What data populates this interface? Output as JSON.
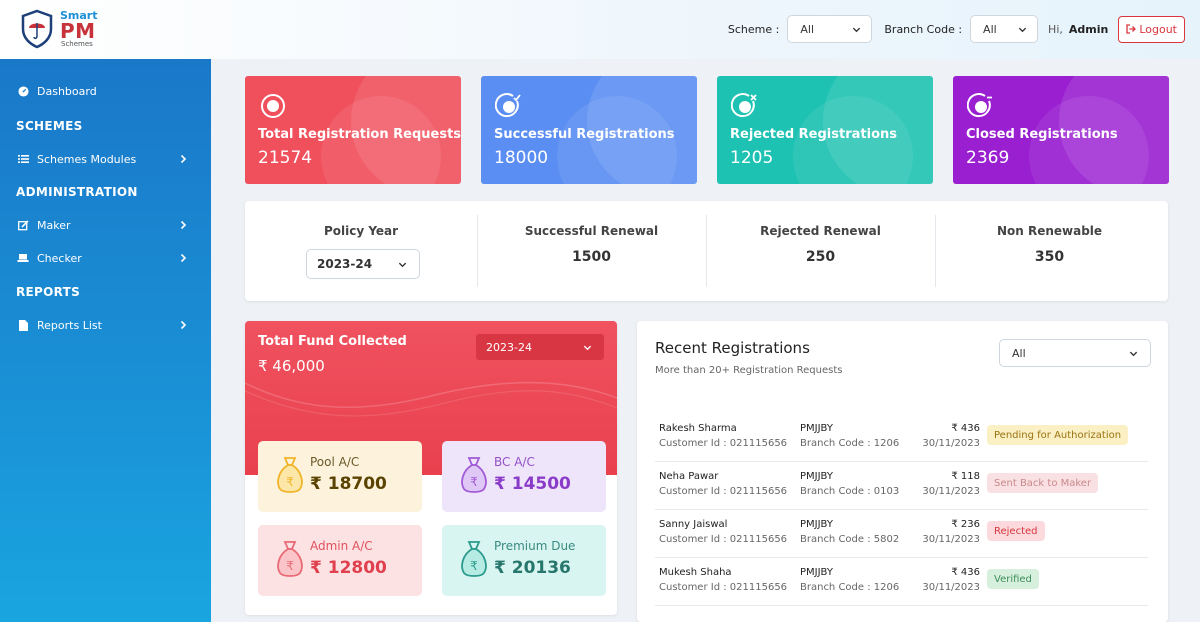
{
  "brand": {
    "smart": "Smart",
    "pm": "PM",
    "schemes": "Schemes"
  },
  "header": {
    "scheme_label": "Scheme :",
    "scheme_value": "All",
    "branch_label": "Branch Code :",
    "branch_value": "All",
    "greeting": "Hi,",
    "user": "Admin",
    "logout": "Logout"
  },
  "sidebar": {
    "dashboard": "Dashboard",
    "schemes_head": "SCHEMES",
    "schemes_modules": "Schemes Modules",
    "admin_head": "ADMINISTRATION",
    "maker": "Maker",
    "checker": "Checker",
    "reports_head": "REPORTS",
    "reports_list": "Reports List"
  },
  "stats": [
    {
      "label": "Total Registration Requests",
      "value": "21574",
      "color": "#f0505c"
    },
    {
      "label": "Successful Registrations",
      "value": "18000",
      "color": "#5b8ef2"
    },
    {
      "label": "Rejected Registrations",
      "value": "1205",
      "color": "#1ec2b2"
    },
    {
      "label": "Closed Registrations",
      "value": "2369",
      "color": "#9a1fd1"
    }
  ],
  "renewal": {
    "policy_year_label": "Policy Year",
    "policy_year_value": "2023-24",
    "successful_label": "Successful Renewal",
    "successful_value": "1500",
    "rejected_label": "Rejected Renewal",
    "rejected_value": "250",
    "non_label": "Non Renewable",
    "non_value": "350"
  },
  "fund": {
    "title": "Total Fund Collected",
    "amount": "₹ 46,000",
    "year": "2023-24",
    "accounts": [
      {
        "label": "Pool A/C",
        "value": "₹ 18700"
      },
      {
        "label": "BC A/C",
        "value": "₹ 14500"
      },
      {
        "label": "Admin A/C",
        "value": "₹ 12800"
      },
      {
        "label": "Premium Due",
        "value": "₹ 20136"
      }
    ]
  },
  "recent": {
    "title": "Recent Registrations",
    "subtitle": "More than 20+ Registration Requests",
    "filter": "All",
    "rows": [
      {
        "name": "Rakesh Sharma",
        "cust": "Customer Id : 021115656",
        "scheme": "PMJJBY",
        "branch": "Branch Code : 1206",
        "amount": "₹ 436",
        "date": "30/11/2023",
        "status": "Pending for Authorization"
      },
      {
        "name": "Neha Pawar",
        "cust": "Customer Id : 021115656",
        "scheme": "PMJJBY",
        "branch": "Branch Code : 0103",
        "amount": "₹ 118",
        "date": "30/11/2023",
        "status": "Sent Back to Maker"
      },
      {
        "name": "Sanny Jaiswal",
        "cust": "Customer Id : 021115656",
        "scheme": "PMJJBY",
        "branch": "Branch Code : 5802",
        "amount": "₹ 236",
        "date": "30/11/2023",
        "status": "Rejected"
      },
      {
        "name": "Mukesh Shaha",
        "cust": "Customer Id : 021115656",
        "scheme": "PMJJBY",
        "branch": "Branch Code : 1206",
        "amount": "₹ 436",
        "date": "30/11/2023",
        "status": "Verified"
      }
    ]
  }
}
